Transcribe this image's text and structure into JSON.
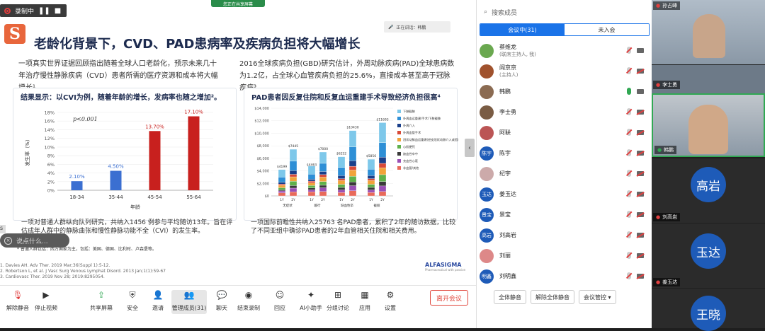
{
  "recording": {
    "label": "录制中"
  },
  "share_banner": "您正在共享屏幕",
  "speaking": "正在讲话：韩鹏",
  "slide": {
    "title": "老龄化背景下，CVD、PAD患病率及疾病负担将大幅增长",
    "left_para": "一项真实世界证据回顾指出随着全球人口老龄化，预示未来几十年治疗慢性静脉疾病（CVD）患者所需的医疗资源和成本将大幅增长¹。",
    "right_para": "2016全球疾病负担(GBD)研究估计，外周动脉疾病(PAD)全球患病数为1.2亿，占全球心血管疾病负担的25.6%，直接成本甚至高于冠脉疾病³。",
    "left_panel_title": "结果显示：以CVI为例，随着年龄的增长，发病率也随之增加²。",
    "right_panel_title": "PAD患者因反复住院和反复血运重建手术导致经济负担很高⁴",
    "left_caption": "一项对普通人群纵向队列研究，共纳入1456 例参与平均随访13年。旨在评估成年人群中的静脉曲张和慢性静脉功能不全（CVI）的发生率。",
    "left_footnote": "* 普通人群包括：西方国家为主，包括：美国、德国、比利时、卢森堡等。",
    "right_caption": "一项国际前瞻性共纳入25763 名PAD患者，累积了2年的随访数据，比较了不同亚组中确诊PAD患者的2年血管相关住院和相关费用。",
    "refs": [
      "1.  Davies AH.  Adv Ther. 2019 Mar;36(Suppl 1):5-12.",
      "2.  Robertson L, et al. J Vasc Surg Venous Lymphat Disord. 2013 Jan;1(1):59-67",
      "3.  Cardiovasc Ther. 2019 Nov 28; 2019:8295054."
    ],
    "brand": "ALFASIGMA",
    "brand_sub": "Pharmaceutical with passion"
  },
  "chart_data": [
    {
      "type": "bar",
      "title": "",
      "xlabel": "年龄",
      "ylabel": "发生率（%）",
      "annotation": "p<0.001",
      "categories": [
        "18-34",
        "35-44",
        "45-54",
        "55-64"
      ],
      "values": [
        2.1,
        4.5,
        13.7,
        17.1
      ],
      "value_labels": [
        "2.10%",
        "4.50%",
        "13.70%",
        "17.10%"
      ],
      "yticks": [
        "0%",
        "2%",
        "4%",
        "6%",
        "8%",
        "10%",
        "12%",
        "14%",
        "16%",
        "18%"
      ],
      "ylim": [
        0,
        18
      ],
      "colors": [
        "#3b6fd1",
        "#3b6fd1",
        "#c8201e",
        "#c8201e"
      ]
    },
    {
      "type": "bar",
      "stacked": true,
      "title": "",
      "groups": [
        "无症状",
        "跛行",
        "缺血性卒",
        "截肢"
      ],
      "bar_labels": [
        "1Y",
        "2Y",
        "1Y",
        "2Y",
        "1Y",
        "2Y",
        "1Y",
        "2Y"
      ],
      "totals": [
        4199,
        7445,
        4463,
        7000,
        6252,
        10430,
        5856,
        11693
      ],
      "total_labels": [
        "$4199",
        "$7445",
        "$4463",
        "$7000",
        "$6252",
        "$10430",
        "$5856",
        "$11693"
      ],
      "yticks": [
        "$0",
        "$2,000",
        "$4,000",
        "$6,000",
        "$8,000",
        "$10,000",
        "$12,000",
        "$14,000"
      ],
      "ylim": [
        0,
        14000
      ],
      "legend": [
        "下肢截肢",
        "外周血运重建/手术/下肢截肢",
        "外周介入",
        "外周血管手术",
        "冠状动脉血运重建(经皮冠状动脉介入或搭桥)",
        "心肌梗死",
        "缺血性卒中",
        "充血性心衰",
        "非血管/其他"
      ],
      "segment_colors": [
        "#7ec8ea",
        "#2e8fd6",
        "#1a3f8a",
        "#d94a38",
        "#f2a33a",
        "#5fb14a",
        "#3a3a3a",
        "#9a4fb5",
        "#e86a5a"
      ],
      "series_values": [
        [
          1200,
          1900,
          1300,
          1800,
          1700,
          2600,
          1600,
          3200
        ],
        [
          800,
          1500,
          800,
          1300,
          1300,
          2200,
          1000,
          2300
        ],
        [
          300,
          600,
          300,
          500,
          500,
          900,
          500,
          1000
        ],
        [
          200,
          400,
          300,
          400,
          300,
          600,
          300,
          700
        ],
        [
          400,
          700,
          400,
          700,
          600,
          1000,
          600,
          1100
        ],
        [
          300,
          700,
          400,
          600,
          500,
          900,
          500,
          1100
        ],
        [
          200,
          400,
          300,
          400,
          400,
          600,
          400,
          700
        ],
        [
          300,
          600,
          300,
          600,
          400,
          800,
          400,
          900
        ],
        [
          499,
          645,
          663,
          700,
          552,
          830,
          556,
          693
        ]
      ]
    }
  ],
  "comment_placeholder": "说点什么...",
  "toolbar": {
    "items": [
      "解除静音",
      "停止视频",
      "共享屏幕",
      "安全",
      "邀请",
      "管理成员(31)",
      "聊天",
      "结束录制",
      "回应",
      "AI小助手",
      "分组讨论",
      "应用",
      "设置"
    ],
    "leave": "离开会议"
  },
  "members_panel": {
    "search_placeholder": "搜索成员",
    "tab_in": "会议中(31)",
    "tab_not": "未入会",
    "members": [
      {
        "name": "蔡维龙",
        "sub": "(联席主持人, 我)",
        "color": "#6aa84f",
        "avatar": ""
      },
      {
        "name": "阎京京",
        "sub": "(主持人)",
        "color": "#a0522d",
        "avatar": ""
      },
      {
        "name": "韩鹏",
        "sub": "",
        "color": "#8b6b52",
        "avatar": ""
      },
      {
        "name": "李士勇",
        "sub": "",
        "color": "#7a5c44",
        "avatar": ""
      },
      {
        "name": "阿联",
        "sub": "",
        "color": "#b55",
        "avatar": ""
      },
      {
        "name": "陈宇",
        "sub": "",
        "color": "#1e5bb8",
        "avatar": "陈宇"
      },
      {
        "name": "纪宇",
        "sub": "",
        "color": "#caa",
        "avatar": ""
      },
      {
        "name": "姜玉达",
        "sub": "",
        "color": "#1e5bb8",
        "avatar": "玉达"
      },
      {
        "name": "景宝",
        "sub": "",
        "color": "#1e5bb8",
        "avatar": "景宝"
      },
      {
        "name": "刘高岩",
        "sub": "",
        "color": "#1e5bb8",
        "avatar": "高岩"
      },
      {
        "name": "刘丽",
        "sub": "",
        "color": "#d88",
        "avatar": ""
      },
      {
        "name": "刘明鑫",
        "sub": "",
        "color": "#1e5bb8",
        "avatar": "明鑫"
      }
    ],
    "mute_all": "全体静音",
    "unmute_all": "解除全体静音",
    "manage": "会议管控"
  },
  "gallery": [
    {
      "name": "孙占峰",
      "type": "video"
    },
    {
      "name": "李士勇",
      "type": "video"
    },
    {
      "name": "韩鹏",
      "type": "video"
    },
    {
      "name": "刘高岩",
      "type": "avatar",
      "avatar": "高岩"
    },
    {
      "name": "姜玉达",
      "type": "avatar",
      "avatar": "玉达"
    },
    {
      "name": "",
      "type": "avatar",
      "avatar": "王晓"
    }
  ]
}
